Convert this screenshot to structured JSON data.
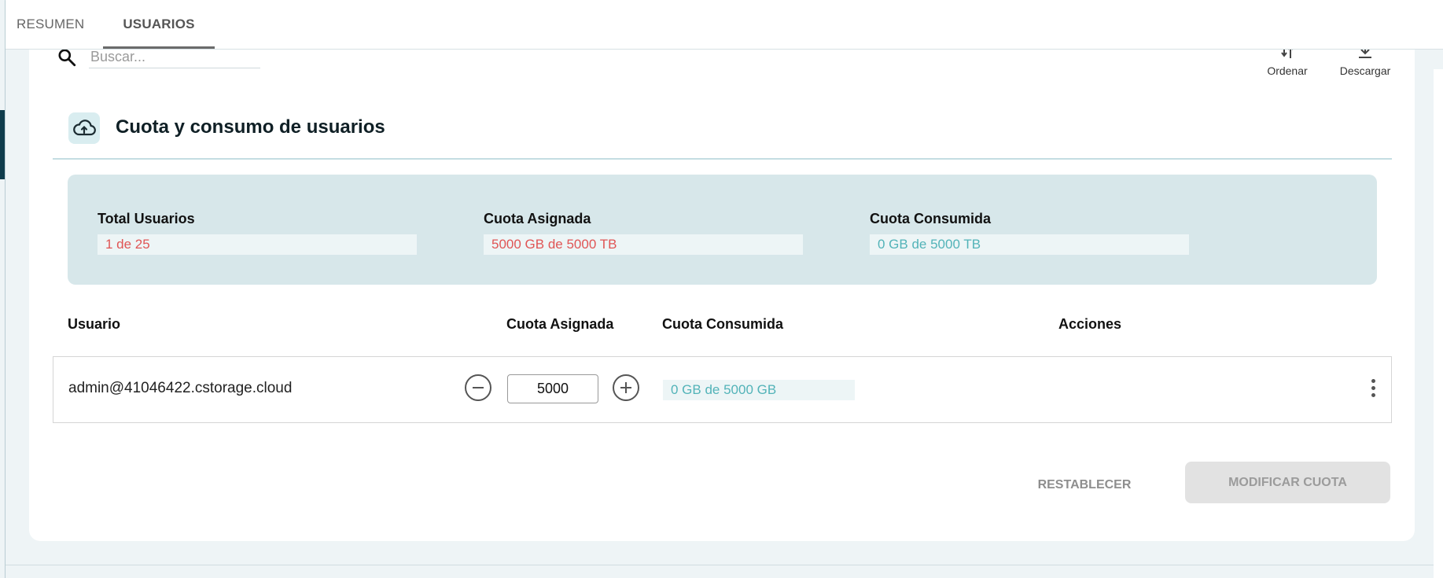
{
  "tabs": [
    {
      "label": "RESUMEN",
      "active": false
    },
    {
      "label": "USUARIOS",
      "active": true
    }
  ],
  "search": {
    "placeholder": "Buscar...",
    "value": ""
  },
  "toolbar": {
    "sort_label": "Ordenar",
    "download_label": "Descargar"
  },
  "section": {
    "title": "Cuota y consumo de usuarios",
    "icon": "cloud-upload-icon"
  },
  "summary": {
    "total_users": {
      "label": "Total Usuarios",
      "value": "1 de 25"
    },
    "assigned_quota": {
      "label": "Cuota Asignada",
      "value": "5000 GB de 5000 TB"
    },
    "consumed_quota": {
      "label": "Cuota Consumida",
      "value": "0 GB de 5000 TB"
    }
  },
  "table": {
    "columns": [
      "Usuario",
      "Cuota Asignada",
      "Cuota Consumida",
      "Acciones"
    ],
    "rows": [
      {
        "user": "admin@41046422.cstorage.cloud",
        "assigned": "5000",
        "consumed": "0 GB de 5000 GB"
      }
    ]
  },
  "actions": {
    "reset_label": "RESTABLECER",
    "modify_label": "MODIFICAR CUOTA"
  },
  "colors": {
    "accent_teal": "#52b3b8",
    "alert_red": "#e05555",
    "summary_bg": "#d7e7ea",
    "nav_dark": "#0f3c4c"
  }
}
